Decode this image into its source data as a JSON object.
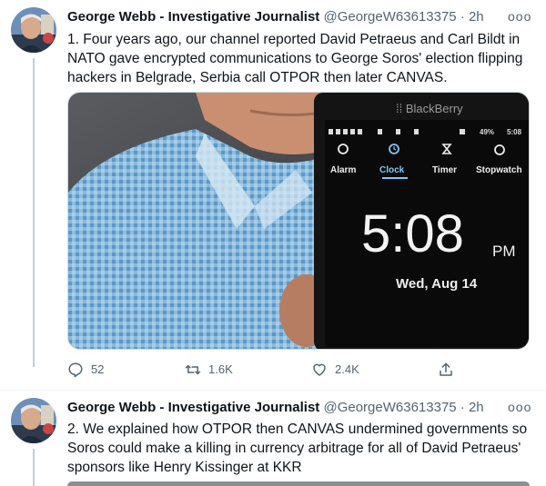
{
  "tweets": [
    {
      "author_name": "George Webb - Investigative Journalist",
      "handle": "@GeorgeW63613375",
      "separator": "·",
      "time": "2h",
      "more_icon": "ooo",
      "text": "1. Four years ago, our channel reported David Petraeus and Carl Bildt in NATO gave encrypted communications to George Soros' election flipping hackers in Belgrade, Serbia call OTPOR then later CANVAS.",
      "media": {
        "brand": "BlackBerry",
        "status_battery": "49%",
        "status_time": "5:08",
        "tabs": [
          "Alarm",
          "Clock",
          "Timer",
          "Stopwatch"
        ],
        "active_tab": "Clock",
        "clock_time": "5:08",
        "clock_ampm": "PM",
        "clock_date": "Wed, Aug 14"
      },
      "actions": {
        "reply_count": "52",
        "retweet_count": "1.6K",
        "like_count": "2.4K"
      }
    },
    {
      "author_name": "George Webb - Investigative Journalist",
      "handle": "@GeorgeW63613375",
      "separator": "·",
      "time": "2h",
      "more_icon": "ooo",
      "text": "2. We explained how OTPOR then CANVAS undermined governments so Soros could make a killing in currency arbitrage for all of David Petraeus' sponsors like Henry Kissinger at KKR"
    }
  ],
  "colors": {
    "text_primary": "#0f1419",
    "text_secondary": "#536471",
    "thread_line": "#c4cfd6",
    "divider": "#eff3f4"
  },
  "icons": {
    "reply": "reply-icon",
    "retweet": "retweet-icon",
    "like": "heart-icon",
    "share": "share-icon",
    "more": "more-dots-icon"
  }
}
